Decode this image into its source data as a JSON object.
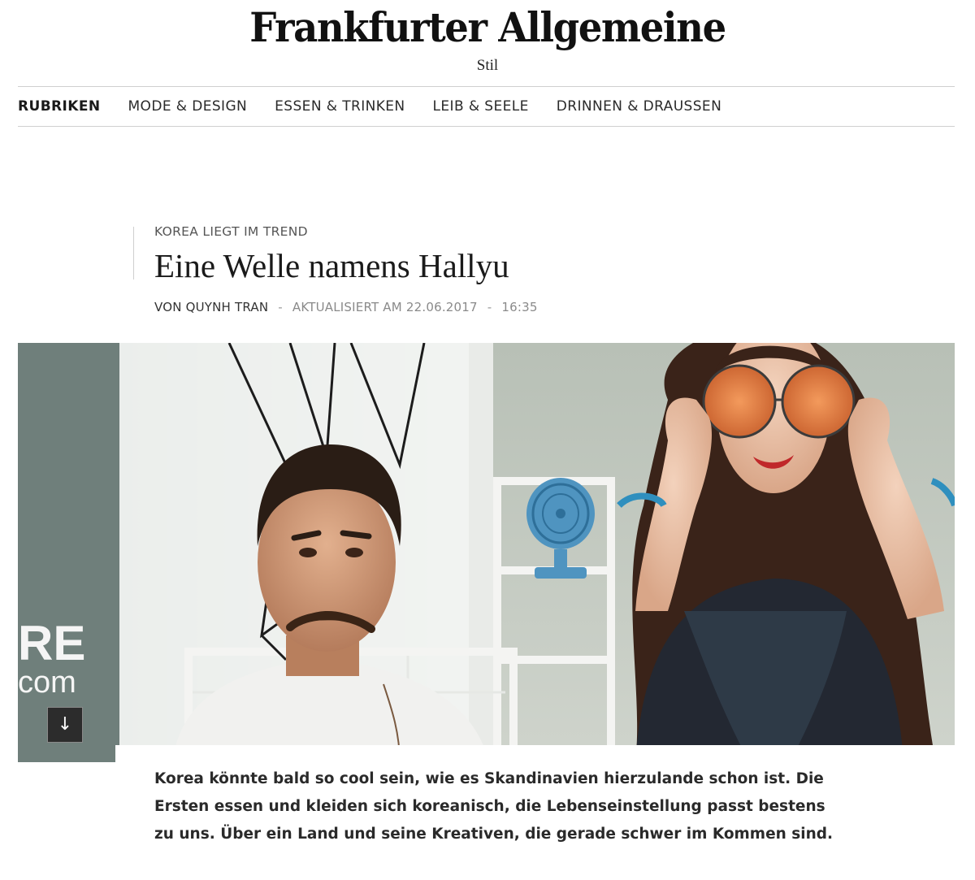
{
  "masthead": {
    "logo": "Frankfurter Allgemeine",
    "section": "Stil"
  },
  "nav": {
    "items": [
      "RUBRIKEN",
      "MODE & DESIGN",
      "ESSEN & TRINKEN",
      "LEIB & SEELE",
      "DRINNEN & DRAUSSEN"
    ]
  },
  "article": {
    "kicker": "KOREA LIEGT IM TREND",
    "headline": "Eine Welle namens Hallyu",
    "author": "VON QUYNH TRAN",
    "separator": "-",
    "updated": "AKTUALISIERT AM 22.06.2017",
    "time": "16:35",
    "teaser": "Korea könnte bald so cool sein, wie es Skandinavien hierzulande schon ist. Die Ersten essen und kleiden sich koreanisch, die Lebenseinstellung passt bestens zu uns. Über ein Land und seine Kreativen, die gerade schwer im Kommen sind."
  },
  "hero": {
    "background_text_line1": "RE",
    "background_text_line2": "com",
    "scroll_icon": "arrow-down-icon",
    "scroll_glyph": "↓"
  }
}
